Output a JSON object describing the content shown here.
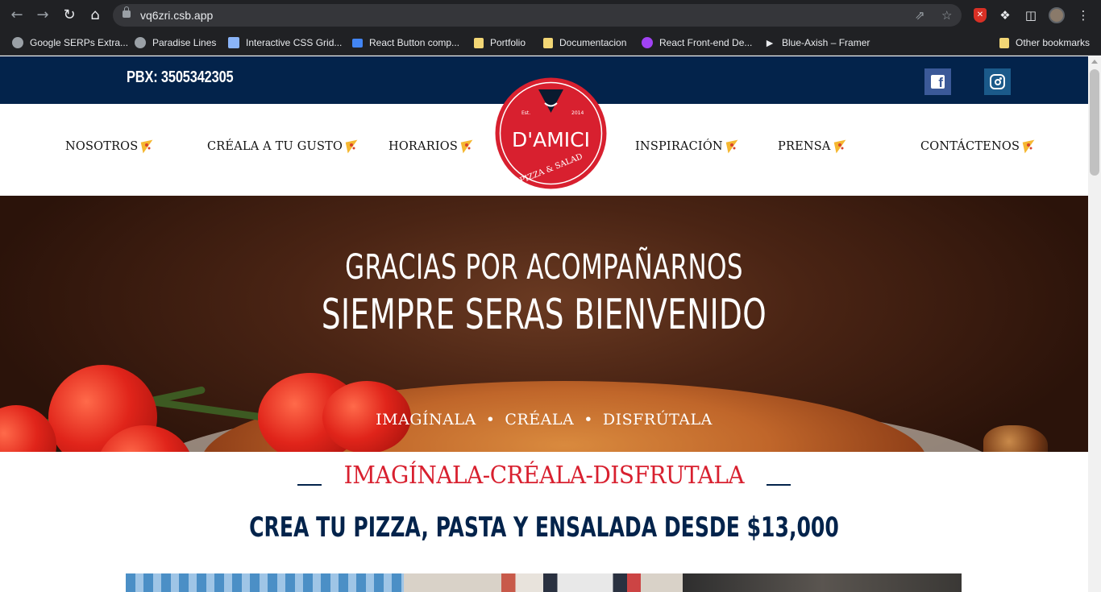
{
  "browser": {
    "url": "vq6zri.csb.app",
    "bookmarks": [
      {
        "label": "Google SERPs Extra...",
        "icon": "globe-icon"
      },
      {
        "label": "Paradise Lines",
        "icon": "globe-icon"
      },
      {
        "label": "Interactive CSS Grid...",
        "icon": "cube-icon"
      },
      {
        "label": "React Button comp...",
        "icon": "app-icon"
      },
      {
        "label": "Portfolio",
        "icon": "folder-icon"
      },
      {
        "label": "Documentacion",
        "icon": "folder-icon"
      },
      {
        "label": "React Front-end De...",
        "icon": "graph-icon"
      },
      {
        "label": "Blue-Axish – Framer",
        "icon": "framer-icon"
      }
    ],
    "other_bookmarks": "Other bookmarks"
  },
  "site": {
    "phone": "PBX: 3505342305",
    "nav_left": [
      "NOSOTROS",
      "CRÉALA A TU GUSTO",
      "HORARIOS"
    ],
    "nav_right": [
      "INSPIRACIÓN",
      "PRENSA",
      "CONTÁCTENOS"
    ],
    "logo": {
      "name": "D'AMICI",
      "est": "Est.",
      "year": "2014",
      "tagline": "PIZZA & SALAD"
    },
    "hero": {
      "line1": "GRACIAS POR ACOMPAÑARNOS",
      "line2": "SIEMPRE SERAS BIENVENIDO",
      "tags": [
        "IMAGÍNALA",
        "CRÉALA",
        "DISFRÚTALA"
      ],
      "separator": "•"
    },
    "section_title": "IMAGÍNALA-CRÉALA-DISFRUTALA",
    "promo": "CREA TU PIZZA, PASTA Y ENSALADA DESDE $13,000"
  },
  "colors": {
    "navy": "#03234b",
    "red": "#d8202f",
    "facebook": "#3b5998"
  }
}
